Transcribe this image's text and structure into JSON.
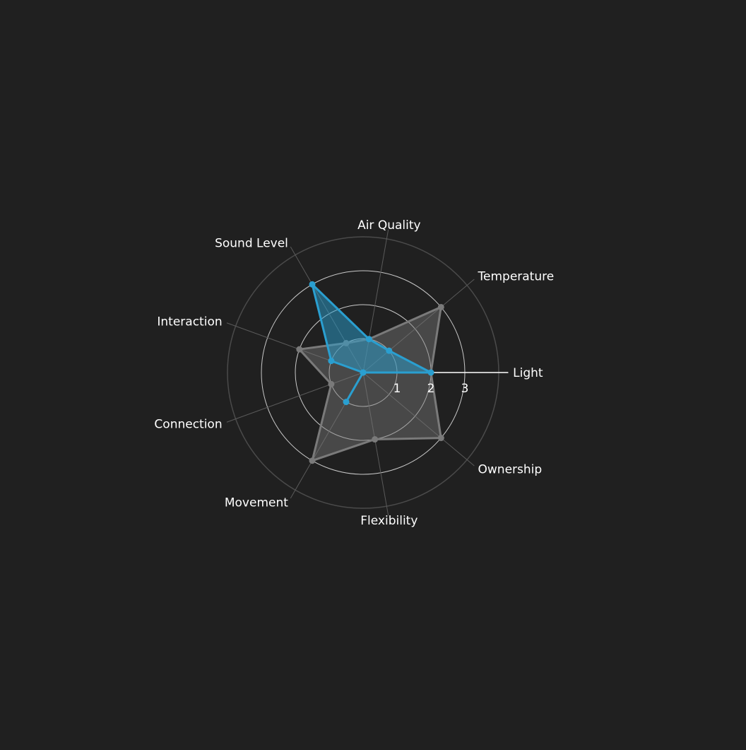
{
  "colors": {
    "background": "#202020",
    "outer_ring": "#4a4a4a",
    "inner_ring": "#c8c8c8",
    "spoke": "#5a5a5a",
    "zero_axis": "#ffffff",
    "series_gray": "#7a7a7a",
    "series_blue": "#2a9fd0"
  },
  "chart_data": {
    "type": "radar",
    "title": "",
    "categories": [
      "Light",
      "Temperature",
      "Air Quality",
      "Sound Level",
      "Interaction",
      "Connection",
      "Movement",
      "Flexibility",
      "Ownership"
    ],
    "axis_angles_deg": [
      0,
      40,
      80,
      120,
      160,
      200,
      240,
      280,
      320
    ],
    "radial_range": [
      0,
      4
    ],
    "radial_ticks": [
      1,
      2,
      3
    ],
    "grid": true,
    "legend": false,
    "series": [
      {
        "color_key": "series_gray",
        "values": [
          2,
          3,
          1,
          1,
          2,
          1,
          3,
          2,
          3
        ]
      },
      {
        "color_key": "series_blue",
        "values": [
          2,
          1,
          1,
          3,
          1,
          0,
          1,
          0,
          0
        ]
      }
    ]
  }
}
